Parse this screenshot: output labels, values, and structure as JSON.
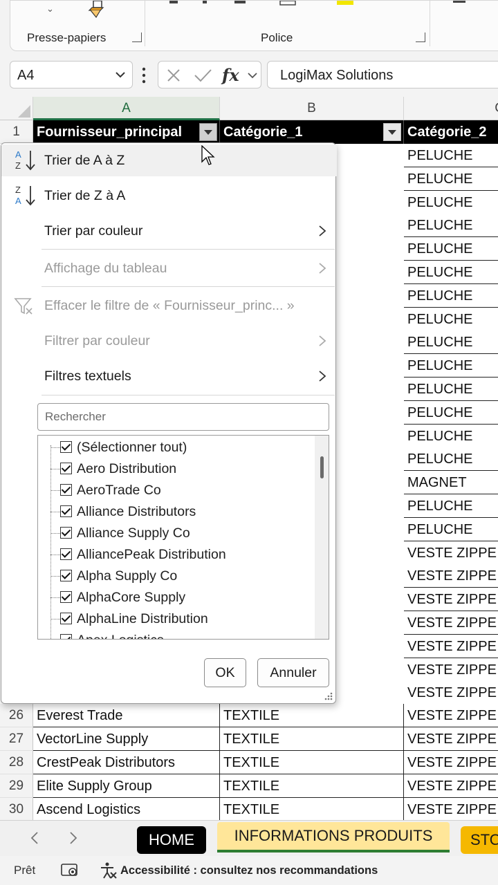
{
  "ribbon": {
    "groups": [
      {
        "label": "Presse-papiers"
      },
      {
        "label": "Police"
      }
    ]
  },
  "formula_bar": {
    "name_box": "A4",
    "fx_label": "fx",
    "formula_value": "LogiMax Solutions"
  },
  "grid": {
    "column_headers": [
      "A",
      "B",
      "C"
    ],
    "selected_column": "A",
    "header_row": {
      "row_number": "1",
      "cells": [
        "Fournisseur_principal",
        "Catégorie_1",
        "Catégorie_2"
      ]
    },
    "visible_col_c": [
      "PELUCHE",
      "PELUCHE",
      "PELUCHE",
      "PELUCHE",
      "PELUCHE",
      "PELUCHE",
      "PELUCHE",
      "PELUCHE",
      "PELUCHE",
      "PELUCHE",
      "PELUCHE",
      "PELUCHE",
      "PELUCHE",
      "PELUCHE",
      "MAGNET",
      "PELUCHE",
      "PELUCHE",
      "VESTE ZIPPE",
      "VESTE ZIPPE",
      "VESTE ZIPPE",
      "VESTE ZIPPE",
      "VESTE ZIPPE",
      "VESTE ZIPPE",
      "VESTE ZIPPE"
    ],
    "rows": [
      {
        "num": "26",
        "a": "Everest Trade",
        "b": "TEXTILE",
        "c": "VESTE ZIPPE"
      },
      {
        "num": "27",
        "a": "VectorLine Supply",
        "b": "TEXTILE",
        "c": "VESTE ZIPPE"
      },
      {
        "num": "28",
        "a": "CrestPeak Distributors",
        "b": "TEXTILE",
        "c": "VESTE ZIPPE"
      },
      {
        "num": "29",
        "a": "Elite Supply Group",
        "b": "TEXTILE",
        "c": "VESTE ZIPPE"
      },
      {
        "num": "30",
        "a": "Ascend Logistics",
        "b": "TEXTILE",
        "c": "VESTE ZIPPE"
      }
    ]
  },
  "filter_menu": {
    "sort_asc": "Trier de A à Z",
    "sort_desc": "Trier de Z à A",
    "sort_by_color": "Trier par couleur",
    "table_view": "Affichage du tableau",
    "clear_filter": "Effacer le filtre de « Fournisseur_princ... »",
    "filter_by_color": "Filtrer par couleur",
    "text_filters": "Filtres textuels",
    "search_placeholder": "Rechercher",
    "items": [
      {
        "label": "(Sélectionner tout)",
        "checked": true
      },
      {
        "label": "Aero Distribution",
        "checked": true
      },
      {
        "label": "AeroTrade Co",
        "checked": true
      },
      {
        "label": "Alliance Distributors",
        "checked": true
      },
      {
        "label": "Alliance Supply Co",
        "checked": true
      },
      {
        "label": "AlliancePeak Distribution",
        "checked": true
      },
      {
        "label": "Alpha Supply Co",
        "checked": true
      },
      {
        "label": "AlphaCore Supply",
        "checked": true
      },
      {
        "label": "AlphaLine Distribution",
        "checked": true
      },
      {
        "label": "Apex Logistics",
        "checked": true
      }
    ],
    "ok_label": "OK",
    "cancel_label": "Annuler"
  },
  "sheet_tabs": {
    "tabs": [
      {
        "label": "HOME",
        "color": "#000000"
      },
      {
        "label": "INFORMATIONS PRODUITS",
        "color": "#ffe699",
        "active": true
      },
      {
        "label": "STO",
        "color": "#f5b800"
      }
    ]
  },
  "status_bar": {
    "ready": "Prêt",
    "accessibility": "Accessibilité : consultez nos recommandations"
  }
}
